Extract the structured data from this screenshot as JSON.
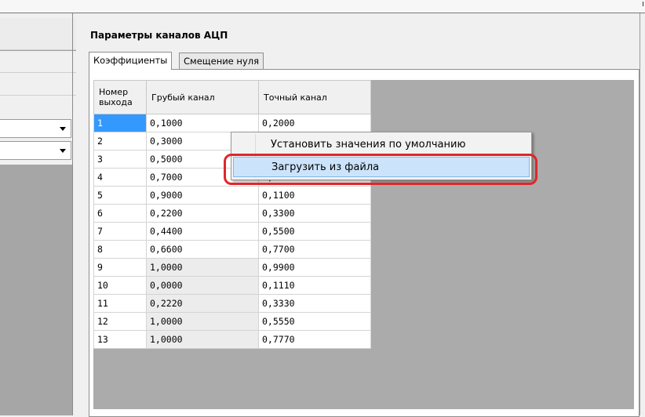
{
  "group_title": "Параметры каналов АЦП",
  "tabs": [
    {
      "label": "Коэффициенты",
      "active": true
    },
    {
      "label": "Смещение нуля",
      "active": false
    }
  ],
  "grid": {
    "columns": [
      "Номер выхода",
      "Грубый канал",
      "Точный канал"
    ],
    "rows": [
      [
        "1",
        "0,1000",
        "0,2000"
      ],
      [
        "2",
        "0,3000",
        ""
      ],
      [
        "3",
        "0,5000",
        ""
      ],
      [
        "4",
        "0,7000",
        "0,8000"
      ],
      [
        "5",
        "0,9000",
        "0,1100"
      ],
      [
        "6",
        "0,2200",
        "0,3300"
      ],
      [
        "7",
        "0,4400",
        "0,5500"
      ],
      [
        "8",
        "0,6600",
        "0,7700"
      ],
      [
        "9",
        "1,0000",
        "0,9900"
      ],
      [
        "10",
        "0,0000",
        "0,1110"
      ],
      [
        "11",
        "0,2220",
        "0,3330"
      ],
      [
        "12",
        "1,0000",
        "0,5550"
      ],
      [
        "13",
        "1,0000",
        "0,7770"
      ]
    ],
    "selected_row": 0
  },
  "context_menu": {
    "items": [
      {
        "label": "Установить значения по умолчанию",
        "highlighted": false
      },
      {
        "label": "Загрузить из файла",
        "highlighted": true
      }
    ]
  },
  "colors": {
    "selection": "#3399ff",
    "menu_highlight": "#cce4fb",
    "annotation": "#e0262a",
    "grid_background": "#ababab"
  }
}
